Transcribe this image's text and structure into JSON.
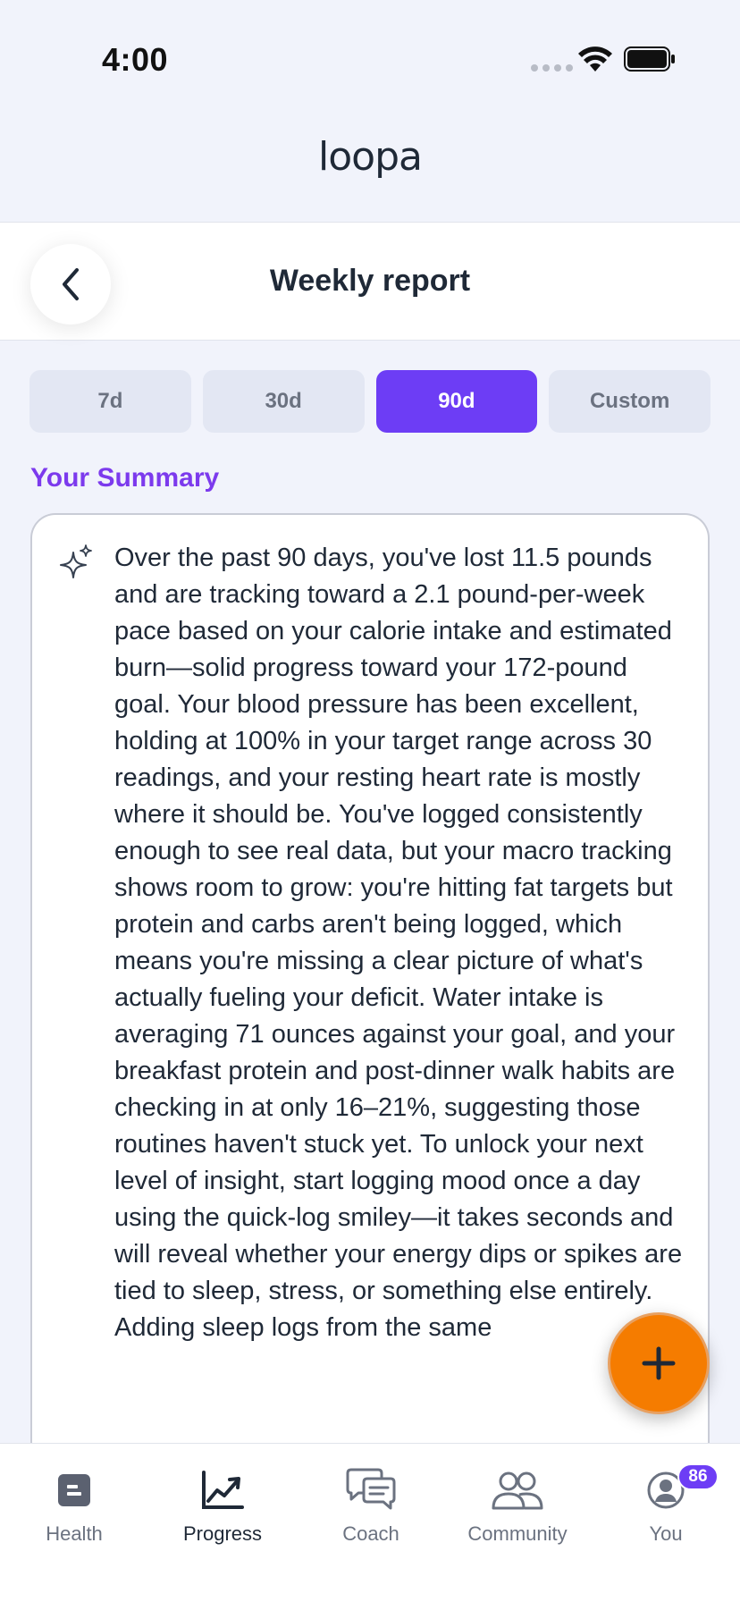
{
  "status_bar": {
    "time": "4:00"
  },
  "brand": {
    "logo_text": "loopa"
  },
  "header": {
    "title": "Weekly report"
  },
  "range_tabs": [
    {
      "label": "7d",
      "active": false
    },
    {
      "label": "30d",
      "active": false
    },
    {
      "label": "90d",
      "active": true
    },
    {
      "label": "Custom",
      "active": false
    }
  ],
  "summary": {
    "heading": "Your Summary",
    "text": "Over the past 90 days, you've lost 11.5 pounds and are tracking toward a 2.1 pound-per-week pace based on your calorie intake and estimated burn—solid progress toward your 172-pound goal. Your blood pressure has been excellent, holding at 100% in your target range across 30 readings, and your resting heart rate is mostly where it should be. You've logged consistently enough to see real data, but your macro tracking shows room to grow: you're hitting fat targets but protein and carbs aren't being logged, which means you're missing a clear picture of what's actually fueling your deficit. Water intake is averaging 71 ounces against your goal, and your breakfast protein and post-dinner walk habits are checking in at only 16–21%, suggesting those routines haven't stuck yet. To unlock your next level of insight, start logging mood once a day using the quick-log smiley—it takes seconds and will reveal whether your energy dips or spikes are tied to sleep, stress, or something else entirely. Adding sleep logs from the same"
  },
  "nav": {
    "items": [
      {
        "label": "Health",
        "icon": "health-icon"
      },
      {
        "label": "Progress",
        "icon": "progress-chart-icon"
      },
      {
        "label": "Coach",
        "icon": "chat-bubbles-icon"
      },
      {
        "label": "Community",
        "icon": "people-icon"
      },
      {
        "label": "You",
        "icon": "profile-icon",
        "badge": "86"
      }
    ]
  },
  "colors": {
    "accent": "#6d3df5",
    "heading": "#7c3aed",
    "fab": "#f57c00"
  }
}
